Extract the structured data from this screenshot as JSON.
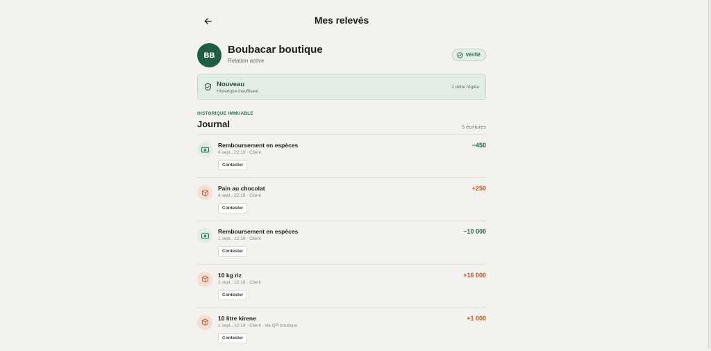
{
  "header": {
    "title": "Mes relevés",
    "back_icon": "arrow-left-icon"
  },
  "merchant": {
    "initials": "BB",
    "name": "Boubacar boutique",
    "status": "Relation active",
    "verified_label": "Vérifié"
  },
  "level": {
    "title": "Nouveau",
    "subtitle": "Historique insuffisant",
    "right_text": "1 dette réglée"
  },
  "journal": {
    "kicker": "HISTORIQUE IMMUABLE",
    "title": "Journal",
    "count": "5 écritures",
    "entries": [
      {
        "title": "Remboursement en espèces",
        "meta": "4 sept., 22:19 · Client",
        "amount": "−450",
        "kind": "cash",
        "contest": "Contester"
      },
      {
        "title": "Pain au chocolat",
        "meta": "4 sept., 22:19 · Client",
        "amount": "+250",
        "kind": "product",
        "contest": "Contester"
      },
      {
        "title": "Remboursement en espèces",
        "meta": "1 sept., 12:16 · Client",
        "amount": "−10 000",
        "kind": "cash",
        "contest": "Contester"
      },
      {
        "title": "10 kg riz",
        "meta": "1 sept., 12:16 · Client",
        "amount": "+16 000",
        "kind": "product",
        "contest": "Contester"
      },
      {
        "title": "10 litre kirene",
        "meta": "1 sept., 12:14 · Client · via QR boutique",
        "amount": "+1 000",
        "kind": "product",
        "contest": "Contester"
      }
    ]
  },
  "colors": {
    "accent": "#1f5e45",
    "positive_amount": "#b5532a",
    "background": "#f3f2ee"
  }
}
